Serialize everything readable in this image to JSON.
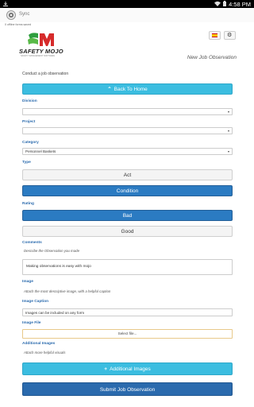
{
  "status_bar": {
    "time": "4:58 PM",
    "icons": [
      "download-icon",
      "wifi-icon",
      "battery-icon"
    ]
  },
  "app_bar": {
    "title": "Sync",
    "icon": "app-logo-icon"
  },
  "offline_note": "0 offline forms saved",
  "header": {
    "logo_text": "SAFETY MOJO",
    "logo_sub": "SAFETY MANAGEMENT SOFTWARE",
    "lang_button_icon": "spain-flag-icon",
    "settings_icon": "gear-icon",
    "settings_glyph": "⚙"
  },
  "page": {
    "heading": "New Job Observation",
    "subtitle": "Conduct a job observation"
  },
  "form": {
    "back_button": {
      "label": "Back To Home",
      "icon": "chevron-up-icon",
      "glyph": "⌃"
    },
    "division": {
      "label": "Division",
      "value": ""
    },
    "project": {
      "label": "Project",
      "value": ""
    },
    "category": {
      "label": "Category",
      "value": "Personnel Baskets"
    },
    "type": {
      "label": "Type",
      "options": [
        {
          "label": "Act",
          "selected": false
        },
        {
          "label": "Condition",
          "selected": true
        }
      ]
    },
    "rating": {
      "label": "Rating",
      "options": [
        {
          "label": "Bad",
          "selected": true
        },
        {
          "label": "Good",
          "selected": false
        }
      ]
    },
    "comments": {
      "label": "Comments",
      "help": "Describe the Observation you made",
      "value": "Making observations is easy with mojo"
    },
    "image": {
      "label": "Image",
      "help": "Attach the most descriptive image, with a helpful caption"
    },
    "image_caption": {
      "label": "Image Caption",
      "value": "Images can be included on any form"
    },
    "image_file": {
      "label": "Image File",
      "button": "Select file..."
    },
    "additional_images": {
      "label": "Additional Images",
      "help": "Attach more helpful visuals",
      "button": "Additional Images",
      "button_glyph": "+"
    },
    "submit": {
      "label": "Submit Job Observation"
    }
  },
  "colors": {
    "cyan": "#3bbde0",
    "blue": "#2b7bc2",
    "label_blue": "#2a6aad",
    "logo_green": "#2e9e3e",
    "logo_red": "#d62b2b"
  }
}
